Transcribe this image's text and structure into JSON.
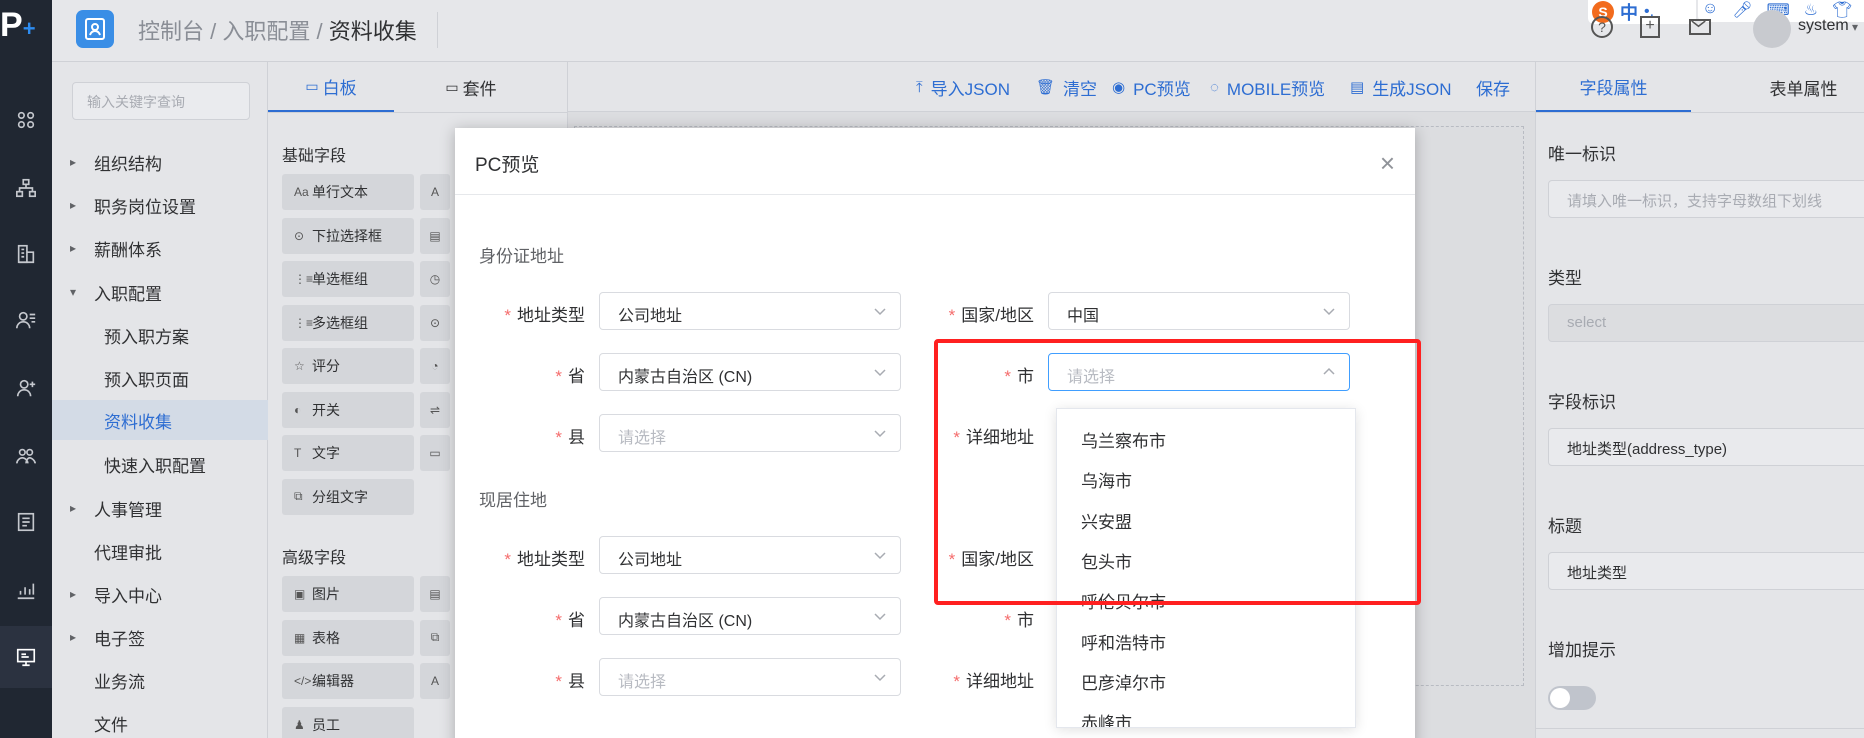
{
  "brand": {
    "logo_letter": "P",
    "logo_plus": "+",
    "accent": "#2d8cf0",
    "frame_color": "#ff2020"
  },
  "breadcrumb": {
    "parent": "控制台 / 入职配置 / ",
    "current": "资料收集"
  },
  "topbar": {
    "user": "system",
    "ime": "中"
  },
  "menu": {
    "search_placeholder": "输入关键字查询",
    "items": [
      {
        "label": "组织结构"
      },
      {
        "label": "职务岗位设置"
      },
      {
        "label": "薪酬体系"
      },
      {
        "label": "入职配置"
      },
      {
        "label": "预入职方案"
      },
      {
        "label": "预入职页面"
      },
      {
        "label": "资料收集"
      },
      {
        "label": "快速入职配置"
      },
      {
        "label": "人事管理"
      },
      {
        "label": "代理审批"
      },
      {
        "label": "导入中心"
      },
      {
        "label": "电子签"
      },
      {
        "label": "业务流"
      },
      {
        "label": "文件"
      }
    ]
  },
  "palette": {
    "tabs": [
      {
        "label": "白板"
      },
      {
        "label": "套件"
      }
    ],
    "basic_title": "基础字段",
    "basic": [
      {
        "label": "单行文本",
        "icon": "Aa",
        "right": "A"
      },
      {
        "label": "下拉选择框",
        "icon": "⊙",
        "right": "▤"
      },
      {
        "label": "单选框组",
        "icon": "⋮≡",
        "right": "◷"
      },
      {
        "label": "多选框组",
        "icon": "⋮≡",
        "right": "⊙"
      },
      {
        "label": "评分",
        "icon": "☆",
        "right": "◔"
      },
      {
        "label": "开关",
        "icon": "◐",
        "right": "⇌"
      },
      {
        "label": "文字",
        "icon": "T",
        "right": "▭"
      },
      {
        "label": "分组文字",
        "icon": "⧉"
      }
    ],
    "adv_title": "高级字段",
    "advanced": [
      {
        "label": "图片",
        "icon": "▣",
        "right": "▤"
      },
      {
        "label": "表格",
        "icon": "▦",
        "right": "⧉"
      },
      {
        "label": "编辑器",
        "icon": "</>",
        "right": "A"
      },
      {
        "label": "员工",
        "icon": "♟"
      }
    ]
  },
  "toolbar": {
    "items": [
      {
        "label": "导入JSON",
        "icon": "upload-icon"
      },
      {
        "label": "清空",
        "icon": "trash-icon"
      },
      {
        "label": "PC预览",
        "icon": "eye-icon"
      },
      {
        "label": "MOBILE预览",
        "icon": "mobile-icon"
      },
      {
        "label": "生成JSON",
        "icon": "file-icon"
      },
      {
        "label": "保存",
        "icon": ""
      }
    ]
  },
  "rpanel": {
    "tabs": [
      {
        "label": "字段属性"
      },
      {
        "label": "表单属性"
      }
    ],
    "uid_label": "唯一标识",
    "uid_placeholder": "请填入唯一标识，支持字母数组下划线",
    "type_label": "类型",
    "type_value": "select",
    "field_label": "字段标识",
    "field_value": "地址类型(address_type)",
    "title_label": "标题",
    "title_value": "地址类型",
    "hint_label": "增加提示"
  },
  "modal": {
    "title": "PC预览",
    "close": "×",
    "group1": "身份证地址",
    "group2": "现居住地",
    "labels": {
      "addr_type": "地址类型",
      "country": "国家/地区",
      "province": "省",
      "city": "市",
      "county": "县",
      "detail": "详细地址"
    },
    "values": {
      "addr_type": "公司地址",
      "country": "中国",
      "province": "内蒙古自治区 (CN)",
      "placeholder": "请选择"
    }
  },
  "dropdown": {
    "options": [
      "乌兰察布市",
      "乌海市",
      "兴安盟",
      "包头市",
      "呼伦贝尔市",
      "呼和浩特市",
      "巴彦淖尔市",
      "赤峰市"
    ]
  }
}
